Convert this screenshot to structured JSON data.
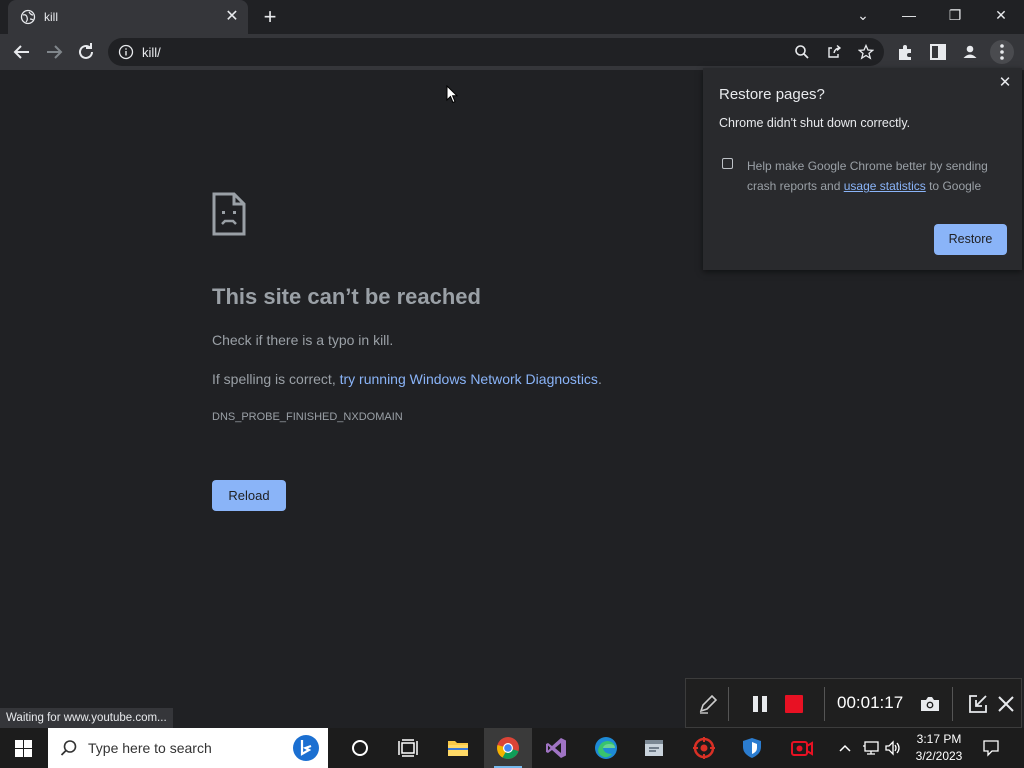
{
  "tab": {
    "title": "kill",
    "close": "✕",
    "new_tab": "+"
  },
  "window_controls": {
    "dropdown": "⌄",
    "minimize": "—",
    "restore": "❐",
    "close": "✕"
  },
  "toolbar": {
    "url": "kill/"
  },
  "error": {
    "title": "This site can’t be reached",
    "typo_text": "Check if there is a typo in kill.",
    "spell_prefix": "If spelling is correct, ",
    "spell_link": "try running Windows Network Diagnostics",
    "spell_suffix": ".",
    "code": "DNS_PROBE_FINISHED_NXDOMAIN",
    "reload_label": "Reload"
  },
  "restore_popup": {
    "heading": "Restore pages?",
    "subheading": "Chrome didn't shut down correctly.",
    "help_prefix": "Help make Google Chrome better by sending crash reports and ",
    "help_link": "usage statistics",
    "help_suffix": " to Google",
    "checkbox_checked": false,
    "restore_label": "Restore"
  },
  "status_bubble": "Waiting for www.youtube.com...",
  "recorder": {
    "elapsed": "00:01:17"
  },
  "taskbar": {
    "search_placeholder": "Type here to search",
    "time": "3:17 PM",
    "date": "3/2/2023"
  },
  "colors": {
    "accent": "#8ab4f8",
    "background": "#202124",
    "toolbar": "#35363a",
    "record_red": "#e81123"
  }
}
